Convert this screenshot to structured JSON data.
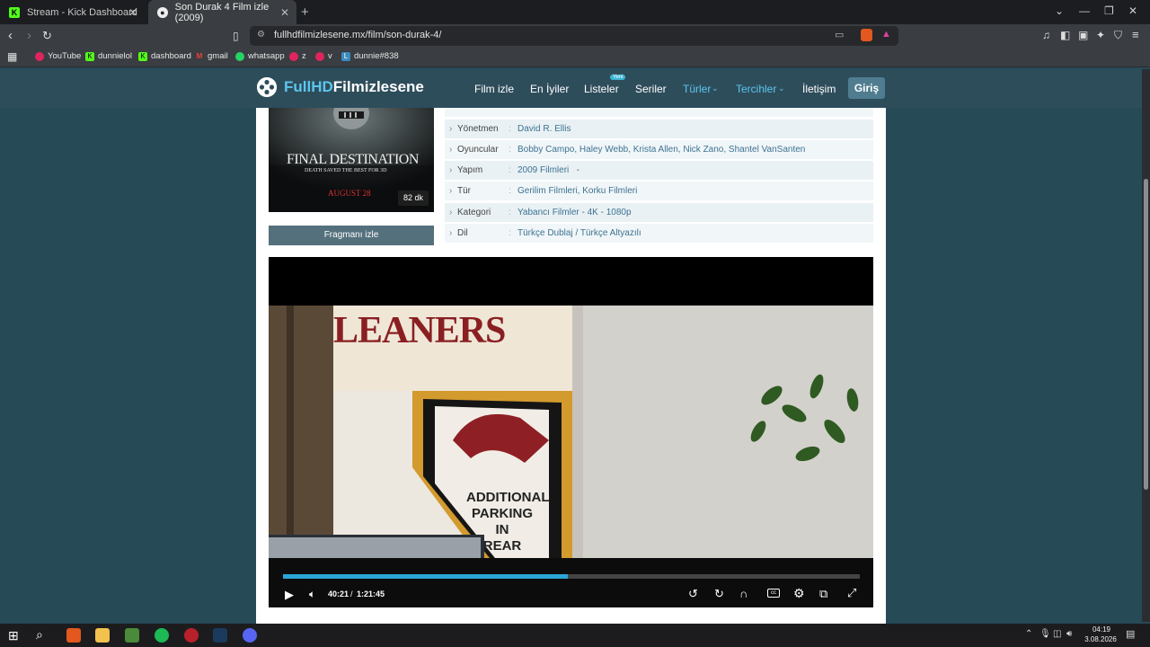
{
  "tabs": [
    {
      "title": "Stream - Kick Dashboard",
      "icon": "kick-icon"
    },
    {
      "title": "Son Durak 4 Film izle (2009)",
      "icon": "film-reel-icon"
    }
  ],
  "address": {
    "url": "fullhdfilmizlesene.mx/film/son-durak-4/"
  },
  "bookmarks": [
    "YouTube",
    "dunnielol",
    "dashboard",
    "gmail",
    "whatsapp",
    "z",
    "v",
    "dunnie#838"
  ],
  "site": {
    "logo_a": "FullHD",
    "logo_b": "Filmizlesene",
    "nav": [
      "Film izle",
      "En İyiler",
      "Listeler",
      "Seriler",
      "Türler",
      "Tercihler",
      "İletişim"
    ],
    "badge": "Yeni",
    "login": "Giriş"
  },
  "poster": {
    "title": "FINAL DESTINATION",
    "tagline": "DEATH SAVED THE BEST FOR 3D",
    "date": "AUGUST 28",
    "duration": "82 dk"
  },
  "trailer_button": "Fragmanı izle",
  "details": [
    {
      "label": "Yönetmen",
      "value": "David R. Ellis"
    },
    {
      "label": "Oyuncular",
      "value": "Bobby Campo, Haley Webb, Krista Allen, Nick Zano, Shantel VanSanten"
    },
    {
      "label": "Yapım",
      "value": "2009 Filmleri   -"
    },
    {
      "label": "Tür",
      "value": "Gerilim Filmleri, Korku Filmleri"
    },
    {
      "label": "Kategori",
      "value": "Yabancı Filmler - 4K - 1080p"
    },
    {
      "label": "Dil",
      "value": "Türkçe Dublaj / Türkçe Altyazılı"
    }
  ],
  "scene": {
    "sign_top": "LEANERS",
    "sign_lines": [
      "ADDITIONAL",
      "PARKING",
      "IN",
      "REAR"
    ]
  },
  "player": {
    "current": "40:21",
    "separator": "/",
    "total": "1:21:45",
    "progress": 0.494
  },
  "taskbar": {
    "time": "04:19",
    "date": "3.08.2026"
  }
}
